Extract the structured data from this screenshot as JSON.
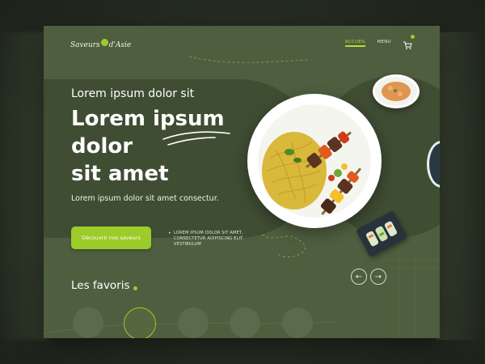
{
  "brand": {
    "name": "Saveurs d'Asie"
  },
  "nav": {
    "items": [
      {
        "label": "ACCUEIL",
        "active": true
      },
      {
        "label": "MENU",
        "active": false
      }
    ],
    "cart_icon": "cart-icon"
  },
  "hero": {
    "kicker": "Lorem ipsum dolor sit",
    "headline_line1": "Lorem ipsum",
    "headline_line2": "dolor",
    "headline_line3": "sit amet",
    "subtitle": "Lorem ipsum dolor sit amet consectur.",
    "cta_label": "Découvrir nos saveurs",
    "tagline": "LOREM IPSUM DOLOR SIT AMET, CONSECTETUR ADIPISCING ELIT. VESTIBULUM"
  },
  "carousel": {
    "prev_icon": "arrow-left-icon",
    "next_icon": "arrow-right-icon",
    "prev_glyph": "←",
    "next_glyph": "→"
  },
  "favorites": {
    "title": "Les favoris",
    "items": 5,
    "active_index": 1
  },
  "colors": {
    "background": "#4e5e3f",
    "band": "#3f4d33",
    "accent": "#9ccc2a",
    "text": "#ffffff"
  }
}
